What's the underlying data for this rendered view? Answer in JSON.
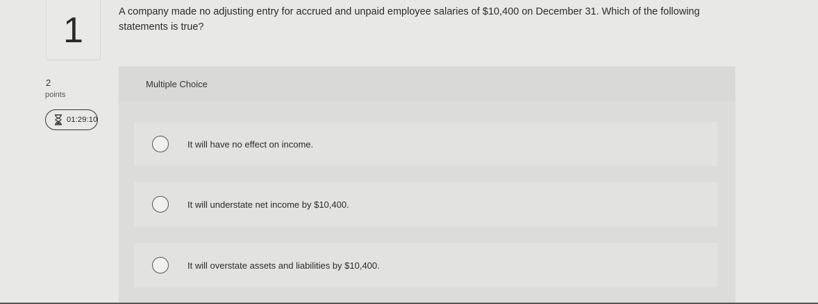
{
  "question": {
    "number": "1",
    "points_value": "2",
    "points_label": "points",
    "timer": "01:29:10",
    "text": "A company made no adjusting entry for accrued and unpaid employee salaries of $10,400 on December 31. Which of the following statements is true?"
  },
  "multiple_choice": {
    "label": "Multiple Choice",
    "options": [
      {
        "text": "It will have no effect on income."
      },
      {
        "text": "It will understate net income by $10,400."
      },
      {
        "text": "It will overstate assets and liabilities by $10,400."
      }
    ]
  },
  "icons": {
    "timer": "hourglass-icon",
    "option": "radio-circle"
  },
  "colors": {
    "background": "#e8e8e6",
    "panel": "#dcdcda",
    "text": "#2b2b2b"
  }
}
